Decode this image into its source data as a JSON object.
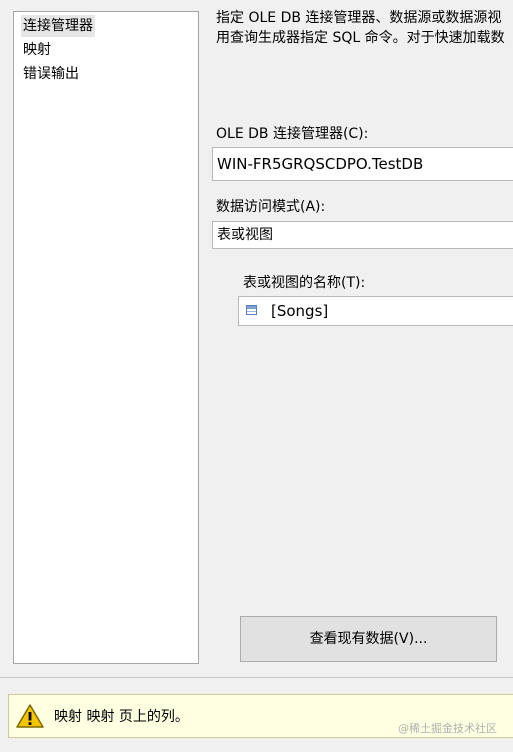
{
  "nav": {
    "items": [
      {
        "label": "连接管理器",
        "selected": true
      },
      {
        "label": "映射",
        "selected": false
      },
      {
        "label": "错误输出",
        "selected": false
      }
    ]
  },
  "description": {
    "line1": "指定 OLE DB 连接管理器、数据源或数据源视",
    "line2": "用查询生成器指定 SQL 命令。对于快速加载数"
  },
  "connection": {
    "label": "OLE DB 连接管理器(C):",
    "value": "WIN-FR5GRQSCDPO.TestDB"
  },
  "access_mode": {
    "label": "数据访问模式(A):",
    "value": "表或视图"
  },
  "table_name": {
    "label": "表或视图的名称(T):",
    "value": "[Songs]",
    "icon": "table-icon"
  },
  "buttons": {
    "preview_label": "查看现有数据(V)..."
  },
  "status": {
    "icon": "warning-icon",
    "message": "映射 映射 页上的列。"
  },
  "watermark": "@稀土掘金技术社区"
}
